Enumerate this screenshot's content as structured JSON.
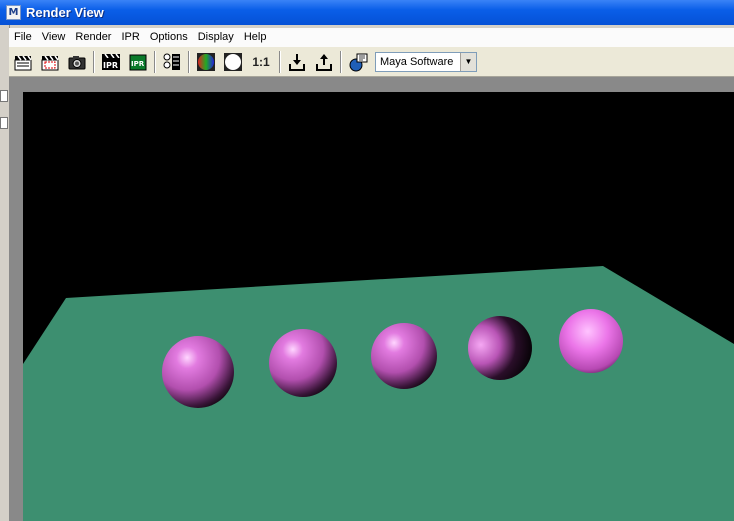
{
  "window": {
    "title": "Render View",
    "app_icon": "maya-icon"
  },
  "menu": [
    "File",
    "View",
    "Render",
    "IPR",
    "Options",
    "Display",
    "Help"
  ],
  "toolbar": {
    "ratio_label": "1:1",
    "renderer_value": "Maya Software",
    "icons": [
      "redo-previous-render-icon",
      "render-region-icon",
      "snapshot-camera-icon",
      "ipr-render-icon",
      "refresh-ipr-icon",
      "render-settings-icon",
      "rgb-channels-icon",
      "alpha-channel-icon",
      "keep-image-icon",
      "remove-image-icon",
      "render-log-icon"
    ]
  },
  "colors": {
    "floor": "#3d8f70",
    "sphere": "#d36ad0",
    "background": "#000000",
    "titlebar": "#0a5ee8"
  }
}
